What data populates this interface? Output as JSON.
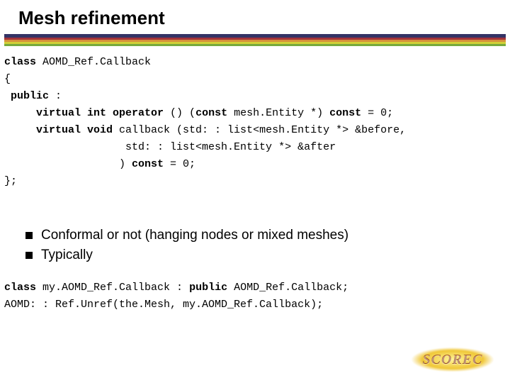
{
  "title": "Mesh refinement",
  "code1": {
    "l0a": "class",
    "l0b": " AOMD_Ref.Callback",
    "l1": "{",
    "l2a": " public",
    "l2b": " :",
    "l3a": "     virtual int operator ",
    "l3b": "() (",
    "l3c": "const",
    "l3d": " mesh.Entity *) ",
    "l3e": "const",
    "l3f": " = 0;",
    "l4a": "     virtual void",
    "l4b": " callback (std: : list<mesh.Entity *> &before,",
    "l5": "                   std: : list<mesh.Entity *> &after",
    "l6a": "                  ) ",
    "l6b": "const",
    "l6c": " = 0;",
    "l7": "};"
  },
  "bullets": [
    "Conformal or not (hanging nodes or mixed meshes)",
    "Typically"
  ],
  "code2": {
    "l0a": "class",
    "l0b": " my.AOMD_Ref.Callback : ",
    "l0c": "public",
    "l0d": " AOMD_Ref.Callback;",
    "l1": "AOMD: : Ref.Unref(the.Mesh, my.AOMD_Ref.Callback);"
  },
  "logo": "SCOREC"
}
